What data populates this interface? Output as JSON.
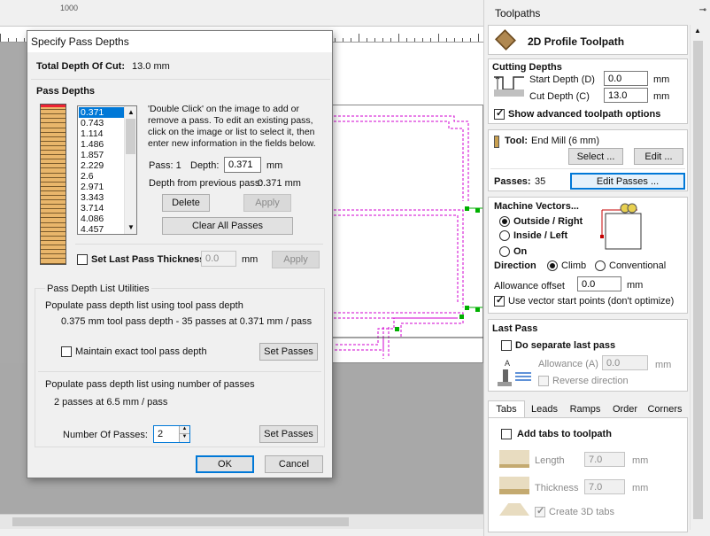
{
  "workspace": {
    "ruler_label": "1000"
  },
  "dialog": {
    "title": "Specify Pass Depths",
    "total_depth_label": "Total Depth Of Cut:",
    "total_depth_value": "13.0 mm",
    "pass_depths_heading": "Pass Depths",
    "passes": [
      "0.371",
      "0.743",
      "1.114",
      "1.486",
      "1.857",
      "2.229",
      "2.6",
      "2.971",
      "3.343",
      "3.714",
      "4.086",
      "4.457"
    ],
    "help_text": "'Double Click' on the image to add or remove a pass. To edit an existing pass, click on the image or list to select it, then enter new information in the fields below.",
    "pass_label": "Pass: 1",
    "depth_label": "Depth:",
    "depth_value": "0.371",
    "depth_unit": "mm",
    "depth_prev_label": "Depth from previous pass:",
    "depth_prev_value": "0.371 mm",
    "delete_btn": "Delete",
    "apply_btn": "Apply",
    "clear_btn": "Clear All Passes",
    "set_last_label": "Set Last Pass Thickness",
    "set_last_value": "0.0",
    "set_last_unit": "mm",
    "apply2_btn": "Apply",
    "utilities_title": "Pass Depth List Utilities",
    "tool_depth_label": "Populate pass depth list using tool pass depth",
    "tool_depth_info": "0.375 mm tool pass depth - 35 passes at 0.371 mm / pass",
    "maintain_label": "Maintain exact tool pass depth",
    "set_passes_btn1": "Set Passes",
    "num_passes_label": "Populate pass depth list using number of passes",
    "num_passes_info": "2 passes at 6.5 mm / pass",
    "number_label": "Number Of Passes:",
    "number_value": "2",
    "set_passes_btn2": "Set Passes",
    "ok_btn": "OK",
    "cancel_btn": "Cancel"
  },
  "panel": {
    "title": "Toolpaths",
    "toolpath_name": "2D Profile Toolpath",
    "cutting_depths_heading": "Cutting Depths",
    "start_depth_label": "Start Depth (D)",
    "start_depth_value": "0.0",
    "cut_depth_label": "Cut Depth (C)",
    "cut_depth_value": "13.0",
    "unit": "mm",
    "show_advanced": "Show advanced toolpath options",
    "tool_label": "Tool:",
    "tool_value": "End Mill (6 mm)",
    "select_btn": "Select ...",
    "edit_btn": "Edit ...",
    "passes_label": "Passes:",
    "passes_value": "35",
    "edit_passes_btn": "Edit Passes ...",
    "machine_vectors_heading": "Machine Vectors...",
    "outside_right": "Outside / Right",
    "inside_left": "Inside / Left",
    "on": "On",
    "direction_label": "Direction",
    "climb": "Climb",
    "conventional": "Conventional",
    "allowance_label": "Allowance offset",
    "allowance_value": "0.0",
    "use_vector_start": "Use vector start points (don't optimize)",
    "last_pass_heading": "Last Pass",
    "do_separate": "Do separate last pass",
    "allowance_a_label": "Allowance (A)",
    "allowance_a_value": "0.0",
    "reverse_direction": "Reverse direction",
    "tabs": [
      "Tabs",
      "Leads",
      "Ramps",
      "Order",
      "Corners"
    ],
    "add_tabs": "Add tabs to toolpath",
    "length_label": "Length",
    "length_value": "7.0",
    "thickness_label": "Thickness",
    "thickness_value": "7.0",
    "create_3d_tabs": "Create 3D tabs",
    "colors": {
      "accent": "#0078d7",
      "selection_line": "#d000d0",
      "node_green": "#00b000"
    }
  }
}
